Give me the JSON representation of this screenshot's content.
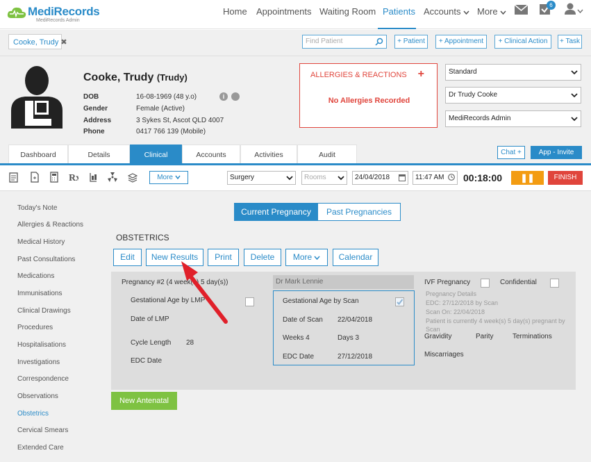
{
  "brand": {
    "name": "MediRecords",
    "tagline": "MediRecords Admin"
  },
  "nav": {
    "items": [
      "Home",
      "Appointments",
      "Waiting Room",
      "Patients",
      "Accounts",
      "More"
    ],
    "active": "Patients",
    "tasks_badge": "6"
  },
  "patient_tag": {
    "label": "Cooke, Trudy",
    "close": "✖"
  },
  "find": {
    "placeholder": "Find Patient"
  },
  "quick_actions": [
    "+ Patient",
    "+ Appointment",
    "+ Clinical Action",
    "+ Task"
  ],
  "patient": {
    "name": "Cooke, Trudy",
    "nickname": "(Trudy)",
    "fields": [
      {
        "label": "DOB",
        "value": "16-08-1969 (48 y.o)"
      },
      {
        "label": "Gender",
        "value": "Female (Active)"
      },
      {
        "label": "Address",
        "value": "3 Sykes St, Ascot QLD 4007"
      },
      {
        "label": "Phone",
        "value": "0417 766 139 (Mobile)"
      }
    ]
  },
  "allergies": {
    "title": "ALLERGIES & REACTIONS",
    "add": "+",
    "message": "No Allergies Recorded"
  },
  "selects": [
    "Standard",
    "Dr Trudy Cooke",
    "MediRecords Admin"
  ],
  "tabs": [
    "Dashboard",
    "Details",
    "Clinical",
    "Accounts",
    "Activities",
    "Audit"
  ],
  "active_tab": "Clinical",
  "chat": {
    "label": "Chat",
    "plus": "+"
  },
  "app_invite": "App - Invite",
  "toolbar": {
    "more": "More",
    "location": "Surgery",
    "rooms": "Rooms",
    "date": "24/04/2018",
    "time": "11:47 AM",
    "timer": "00:18:00",
    "pause": "❚❚",
    "finish": "FINISH"
  },
  "sidebar": {
    "items": [
      "Today's Note",
      "Allergies & Reactions",
      "Medical History",
      "Past Consultations",
      "Medications",
      "Immunisations",
      "Clinical Drawings",
      "Procedures",
      "Hospitalisations",
      "Investigations",
      "Correspondence",
      "Observations",
      "Obstetrics",
      "Cervical Smears",
      "Extended Care"
    ],
    "active": "Obstetrics"
  },
  "pregnancy_tabs": {
    "current": "Current Pregnancy",
    "past": "Past Pregnancies"
  },
  "obstetrics": {
    "title": "OBSTETRICS",
    "actions": [
      "Edit",
      "New Results",
      "Print",
      "Delete",
      "More",
      "Calendar"
    ],
    "pregnancy_label": "Pregnancy #2 (4 week(s) 5 day(s))",
    "gest_lmp": "Gestational Age by LMP",
    "date_lmp": "Date of LMP",
    "cycle_length_label": "Cycle Length",
    "cycle_length_value": "28",
    "edc_date_label": "EDC Date",
    "doctor": "Dr Mark Lennie",
    "scan": {
      "gest_scan": "Gestational Age by Scan",
      "date_of_scan_label": "Date of Scan",
      "date_of_scan_value": "22/04/2018",
      "weeks": "Weeks 4",
      "days": "Days 3",
      "edc_label": "EDC Date",
      "edc_value": "27/12/2018"
    },
    "ivf": "IVF Pregnancy",
    "confidential": "Confidential",
    "details": [
      "Pregnancy Details",
      "EDC: 27/12/2018 by Scan",
      "Scan On: 22/04/2018",
      "Patient is currently 4 week(s) 5 day(s) pregnant by",
      "Scan"
    ],
    "gravidity": "Gravidity",
    "parity": "Parity",
    "terminations": "Terminations",
    "miscarriages": "Miscarriages",
    "new_antenatal": "New Antenatal"
  },
  "colors": {
    "accent": "#2a8bc8",
    "alert": "#e0453c",
    "pause": "#f39c12",
    "success": "#7ec242",
    "arrow": "#e0202a"
  }
}
